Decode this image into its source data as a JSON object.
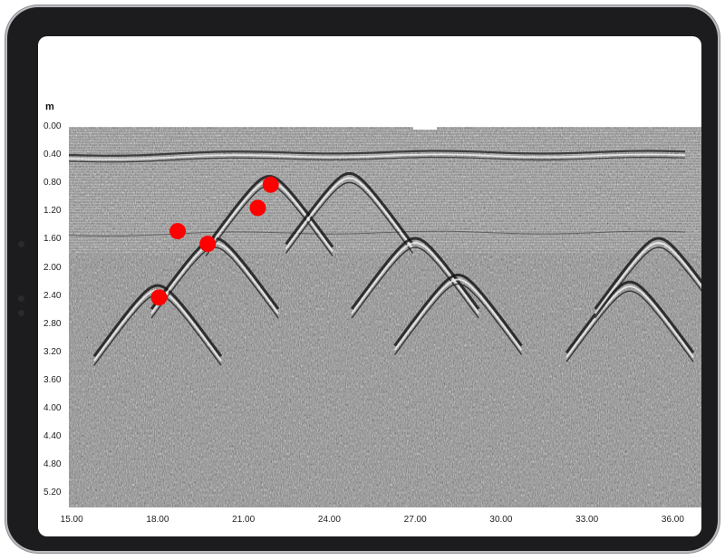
{
  "axis": {
    "depth_unit": "m",
    "depth_ticks": [
      "0.00",
      "0.40",
      "0.80",
      "1.20",
      "1.60",
      "2.00",
      "2.40",
      "2.80",
      "3.20",
      "3.60",
      "4.00",
      "4.40",
      "4.80",
      "5.20"
    ],
    "distance_ticks": [
      "15.00",
      "18.00",
      "21.00",
      "24.00",
      "27.00",
      "30.00",
      "33.00",
      "36.00"
    ]
  },
  "colors": {
    "marker": "#ff0000",
    "background_gray": "#8a8a8a"
  },
  "chart_data": {
    "type": "scatter",
    "title": "",
    "xlabel": "",
    "ylabel": "m",
    "xlim": [
      14.9,
      37.0
    ],
    "ylim": [
      0.0,
      5.4
    ],
    "y_inverted": true,
    "series": [
      {
        "points": [
          {
            "x": 18.7,
            "y": 1.48
          },
          {
            "x": 19.75,
            "y": 1.66
          },
          {
            "x": 21.5,
            "y": 1.15
          },
          {
            "x": 21.95,
            "y": 0.82
          },
          {
            "x": 18.05,
            "y": 2.42
          }
        ]
      }
    ],
    "hyperbolas": [
      {
        "x": 18.0,
        "y": 2.25
      },
      {
        "x": 20.0,
        "y": 1.58
      },
      {
        "x": 21.9,
        "y": 0.7
      },
      {
        "x": 24.7,
        "y": 0.66
      },
      {
        "x": 27.0,
        "y": 1.58
      },
      {
        "x": 28.5,
        "y": 2.1
      },
      {
        "x": 34.5,
        "y": 2.2
      },
      {
        "x": 35.5,
        "y": 1.58
      }
    ]
  }
}
